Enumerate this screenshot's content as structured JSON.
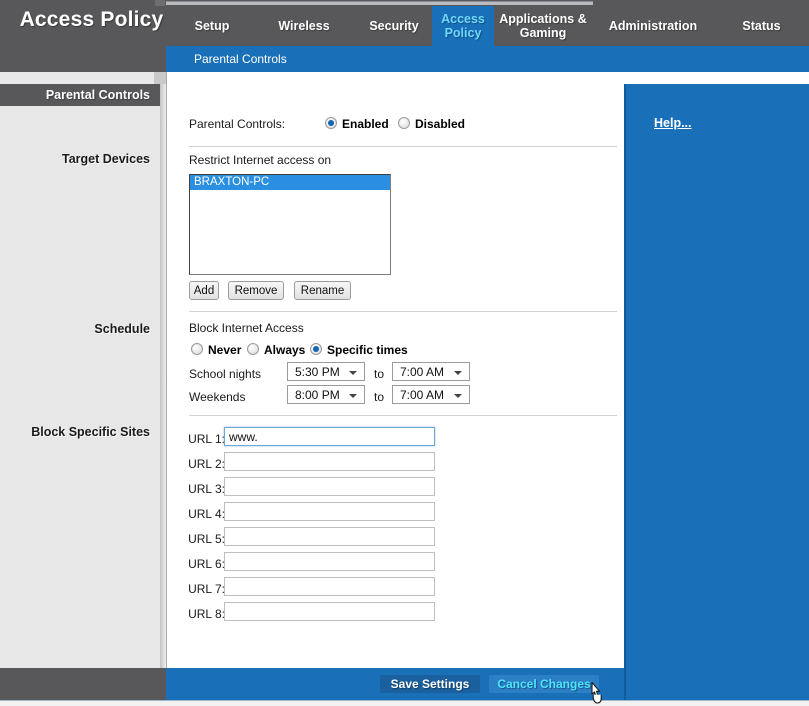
{
  "header": {
    "brand_title": "Access Policy",
    "tabs": [
      {
        "label": "Setup",
        "active": false
      },
      {
        "label": "Wireless",
        "active": false
      },
      {
        "label": "Access Policy",
        "active": true
      },
      {
        "label": "Security",
        "active": false
      },
      {
        "label": "Applications & Gaming",
        "active": false
      },
      {
        "label": "Administration",
        "active": false
      },
      {
        "label": "Status",
        "active": false
      }
    ],
    "subnav_item": "Parental Controls"
  },
  "sidebar": {
    "header": "Parental Controls",
    "labels": [
      "Target Devices",
      "Schedule",
      "Block Specific Sites"
    ]
  },
  "main": {
    "parental_controls_label": "Parental Controls:",
    "enabled_label": "Enabled",
    "disabled_label": "Disabled",
    "parental_controls_value": "Enabled",
    "restrict_label": "Restrict Internet access on",
    "device_list": [
      "BRAXTON-PC"
    ],
    "selected_device": "BRAXTON-PC",
    "buttons": {
      "add": "Add",
      "remove": "Remove",
      "rename": "Rename"
    },
    "block_access_label": "Block Internet Access",
    "block_options": [
      "Never",
      "Always",
      "Specific times"
    ],
    "block_selected": "Specific times",
    "school_nights_label": "School nights",
    "weekends_label": "Weekends",
    "to_label": "to",
    "school_nights_from": "5:30 PM",
    "school_nights_to": "7:00 AM",
    "weekends_from": "8:00 PM",
    "weekends_to": "7:00 AM",
    "url_labels": [
      "URL 1:",
      "URL 2:",
      "URL 3:",
      "URL 4:",
      "URL 5:",
      "URL 6:",
      "URL 7:",
      "URL 8:"
    ],
    "url_values": [
      "www.",
      "",
      "",
      "",
      "",
      "",
      "",
      ""
    ],
    "url_focused_index": 0
  },
  "right_panel": {
    "help_label": "Help..."
  },
  "footer": {
    "save_label": "Save Settings",
    "cancel_label": "Cancel Changes",
    "cancel_hovered": true
  },
  "colors": {
    "header_gray": "#58585a",
    "accent_blue": "#1a70b8",
    "active_tab_text": "#6fd8ff",
    "selection_blue": "#2a8fe0",
    "sidebar_gray": "#e7e7e7"
  }
}
